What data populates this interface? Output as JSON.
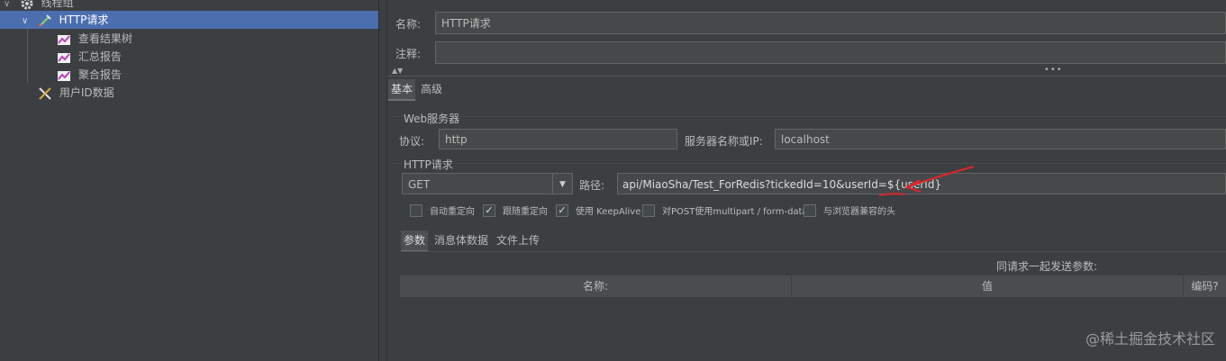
{
  "tree": {
    "items": [
      {
        "label": "线程组",
        "icon": "gear-icon"
      },
      {
        "label": "HTTP请求",
        "icon": "pipette-icon"
      },
      {
        "label": "查看结果树",
        "icon": "chart-icon"
      },
      {
        "label": "汇总报告",
        "icon": "chart-icon"
      },
      {
        "label": "聚合报告",
        "icon": "chart-icon"
      },
      {
        "label": "用户ID数据",
        "icon": "tools-icon"
      }
    ]
  },
  "form": {
    "name_label": "名称:",
    "name_value": "HTTP请求",
    "comment_label": "注释:",
    "comment_value": ""
  },
  "config_tabs": [
    "基本",
    "高级"
  ],
  "web_server": {
    "section_title": "Web服务器",
    "protocol_label": "协议:",
    "protocol_value": "http",
    "server_label": "服务器名称或IP:",
    "server_value": "localhost"
  },
  "http_request": {
    "section_title": "HTTP请求",
    "method_value": "GET",
    "path_label": "路径:",
    "path_value": "api/MiaoSha/Test_ForRedis?tickedId=10&userId=${userId}"
  },
  "options": [
    {
      "label": "自动重定向",
      "checked": false
    },
    {
      "label": "跟随重定向",
      "checked": true
    },
    {
      "label": "使用 KeepAlive",
      "checked": true
    },
    {
      "label": "对POST使用multipart / form-data",
      "checked": false
    },
    {
      "label": "与浏览器兼容的头",
      "checked": false
    }
  ],
  "param_tabs": [
    "参数",
    "消息体数据",
    "文件上传"
  ],
  "params": {
    "caption": "同请求一起发送参数:",
    "columns": [
      "名称:",
      "值",
      "编码?"
    ]
  },
  "watermark": "@稀土掘金技术社区",
  "colors": {
    "selection": "#4b6eaf",
    "annotation": "#e0242a"
  }
}
